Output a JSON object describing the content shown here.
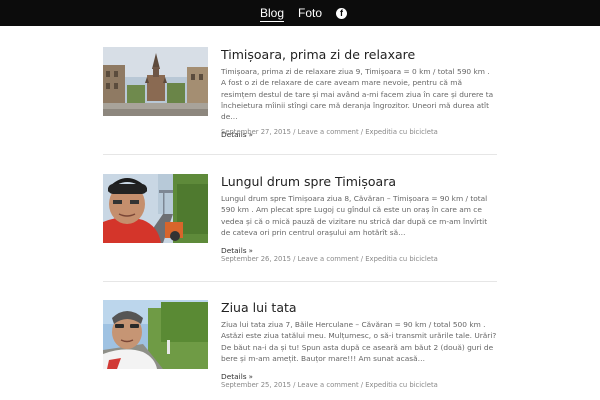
{
  "nav": {
    "blog": "Blog",
    "foto": "Foto",
    "facebook_icon": "facebook-icon"
  },
  "posts": [
    {
      "title": "Timișoara, prima zi de relaxare",
      "excerpt": "Timișoara, prima zi de relaxare ziua 9, Timișoara = 0 km / total 590 km . A fost o zi de relaxare de care aveam mare nevoie, pentru că mă resimțem destul de tare și mai având a-mi facem ziua în care și durere ta încheietura mîinii stîngi care mă deranja îngrozitor. Uneori mă durea atît de…",
      "details": "Details",
      "date": "September 27, 2015",
      "comment": "Leave a comment",
      "category": "Expeditia cu bicicleta"
    },
    {
      "title": "Lungul drum spre Timișoara",
      "excerpt": "Lungul drum spre Timișoara ziua 8, Căvăran – Timișoara = 90 km / total 590 km . Am plecat spre Lugoj cu gîndul că este un oraș în care am ce vedea și că o mică pauză de vizitare nu strică dar după ce m-am învîrtit de cateva ori prin centrul orașului am hotărît să…",
      "details": "Details",
      "date": "September 26, 2015",
      "comment": "Leave a comment",
      "category": "Expeditia cu bicicleta"
    },
    {
      "title": "Ziua lui tata",
      "excerpt": "Ziua lui tata ziua 7, Băile Herculane – Căvăran = 90 km / total 500 km . Astăzi este ziua tatălui meu. Mulțumesc, o să-i transmit urările tale. Urări? De băut na-i da și tu! Spun asta după ce aseară am băut 2 (două) guri de bere și m-am amețit. Bauțor mare!!! Am sunat acasă…",
      "details": "Details",
      "date": "September 25, 2015",
      "comment": "Leave a comment",
      "category": "Expeditia cu bicicleta"
    }
  ]
}
